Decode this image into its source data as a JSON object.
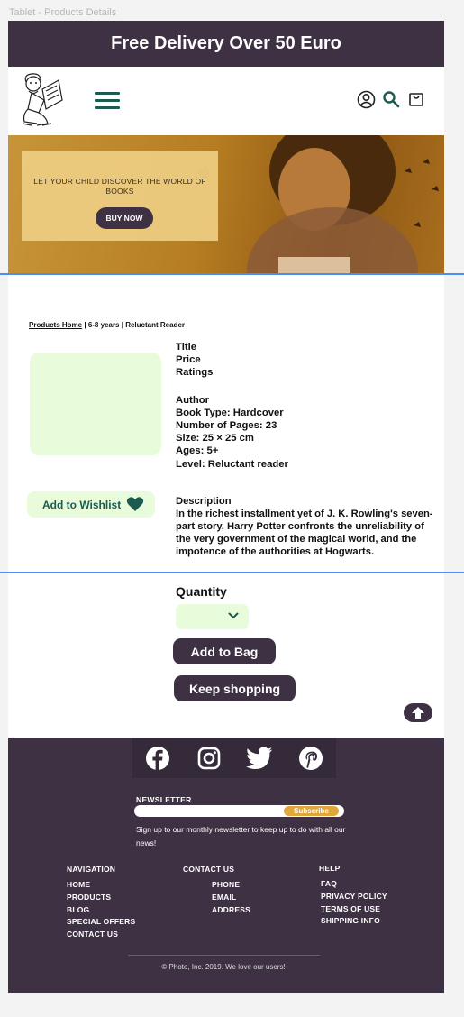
{
  "frame_label": "Tablet - Products Details",
  "promo": {
    "text": "Free Delivery Over 50 Euro"
  },
  "header": {
    "logo_icon": "reading-child-logo",
    "menu_icon": "hamburger-menu-icon",
    "icons": [
      "user-icon",
      "search-icon",
      "shopping-bag-icon"
    ]
  },
  "hero": {
    "tagline": "LET YOUR CHILD DISCOVER THE WORLD OF BOOKS",
    "cta": "BUY NOW"
  },
  "breadcrumb": {
    "home": "Products Home",
    "sep": " | ",
    "age": "6-8 years",
    "level": "Reluctant Reader"
  },
  "product": {
    "title": "Title",
    "price": "Price",
    "ratings": "Ratings",
    "author": "Author",
    "book_type": "Book Type: Hardcover",
    "pages": "Number of Pages: 23",
    "size": "Size: 25 × 25 cm",
    "ages": "Ages: 5+",
    "level": "Level: Reluctant reader",
    "description_label": "Description",
    "description": "In the richest installment yet of J. K. Rowling's seven-part story, Harry Potter confronts the unreliability of the very government of the magical world, and the impotence of the authorities at Hogwarts."
  },
  "wishlist": {
    "label": "Add to Wishlist"
  },
  "quantity": {
    "label": "Quantity",
    "value": ""
  },
  "buttons": {
    "add_to_bag": "Add to Bag",
    "keep_shopping": "Keep shopping"
  },
  "footer": {
    "social": [
      "facebook-icon",
      "instagram-icon",
      "twitter-icon",
      "pinterest-icon"
    ],
    "newsletter": {
      "title": "NEWSLETTER",
      "placeholder": "",
      "button": "Subscribe",
      "text": "Sign up to our monthly newsletter to keep up to do with all our news!"
    },
    "navigation": {
      "title": "NAVIGATION",
      "items": [
        "HOME",
        "PRODUCTS",
        "BLOG",
        "SPECIAL OFFERS",
        "CONTACT US"
      ]
    },
    "contact": {
      "title": "CONTACT US",
      "items": [
        "PHONE",
        "EMAIL",
        "ADDRESS"
      ]
    },
    "help": {
      "title": "HELP",
      "items": [
        "FAQ",
        "PRIVACY POLICY",
        "TERMS OF USE",
        "SHIPPING INFO"
      ]
    },
    "copyright": "© Photo, Inc. 2019. We love our users!"
  },
  "colors": {
    "primary": "#3e3144",
    "accent_green": "#1d5a4f",
    "light_green": "#e8fcdc",
    "subscribe": "#e0a83a",
    "guide_line": "#4a8ef5"
  }
}
